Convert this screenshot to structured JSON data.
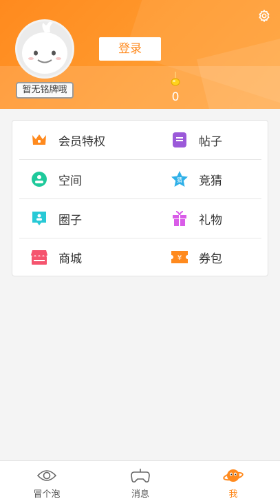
{
  "header": {
    "badge_label": "暂无铭牌哦",
    "login_label": "登录",
    "coin_count": "0",
    "settings_icon": "gear-icon",
    "accent_color": "#ff8a1e"
  },
  "menu": {
    "items": [
      {
        "label": "会员特权",
        "icon": "crown-icon",
        "color": "#ff8a1e"
      },
      {
        "label": "帖子",
        "icon": "note-icon",
        "color": "#9b59d9"
      },
      {
        "label": "空间",
        "icon": "profile-space-icon",
        "color": "#1ec99b"
      },
      {
        "label": "竞猜",
        "icon": "guess-star-icon",
        "color": "#2fb0e8",
        "icon_text": "猜"
      },
      {
        "label": "圈子",
        "icon": "circle-group-icon",
        "color": "#28c9d6"
      },
      {
        "label": "礼物",
        "icon": "gift-icon",
        "color": "#d95ce8"
      },
      {
        "label": "商城",
        "icon": "shop-icon",
        "color": "#f5546e"
      },
      {
        "label": "券包",
        "icon": "coupon-icon",
        "color": "#ff8a1e",
        "icon_text": "¥"
      }
    ]
  },
  "tabs": [
    {
      "label": "冒个泡",
      "icon": "eye-icon",
      "active": false
    },
    {
      "label": "消息",
      "icon": "gamepad-icon",
      "active": false
    },
    {
      "label": "我",
      "icon": "planet-icon",
      "active": true
    }
  ]
}
